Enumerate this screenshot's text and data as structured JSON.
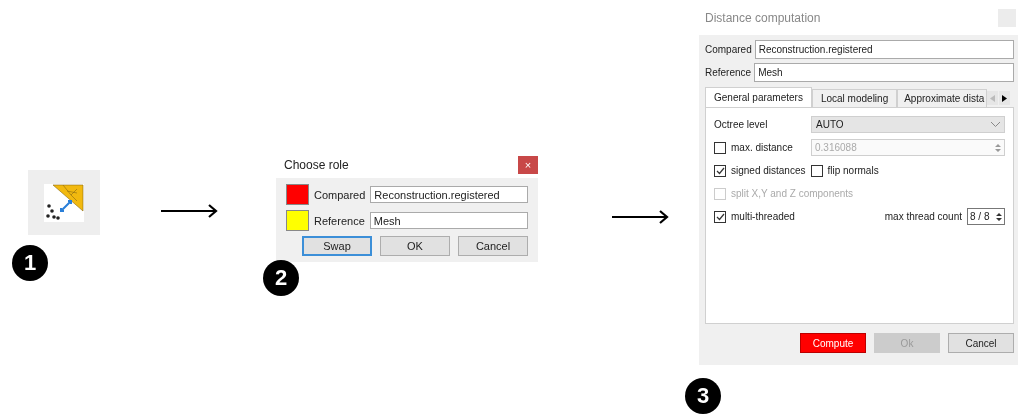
{
  "step_badges": [
    "1",
    "2",
    "3"
  ],
  "choose_role": {
    "title": "Choose role",
    "close": "×",
    "rows": [
      {
        "label": "Compared",
        "value": "Reconstruction.registered",
        "color": "#ff0000"
      },
      {
        "label": "Reference",
        "value": "Mesh",
        "color": "#ffff00"
      }
    ],
    "buttons": [
      {
        "label": "Swap",
        "selected": true
      },
      {
        "label": "OK",
        "selected": false
      },
      {
        "label": "Cancel",
        "selected": false
      }
    ]
  },
  "distance_computation": {
    "title": "Distance computation",
    "fields": [
      {
        "label": "Compared",
        "value": "Reconstruction.registered"
      },
      {
        "label": "Reference",
        "value": "Mesh"
      }
    ],
    "tabs": [
      {
        "label": "General parameters",
        "selected": true
      },
      {
        "label": "Local modeling",
        "selected": false
      },
      {
        "label": "Approximate dista",
        "selected": false
      }
    ],
    "octree_level": {
      "label": "Octree level",
      "value": "AUTO"
    },
    "max_distance": {
      "label": "max. distance",
      "checked": false,
      "value": "0.316088"
    },
    "signed_distances": {
      "label": "signed distances",
      "checked": true
    },
    "flip_normals": {
      "label": "flip normals",
      "checked": false
    },
    "split_components": {
      "label": "split X,Y and Z components",
      "checked": false,
      "disabled": true
    },
    "multi_threaded": {
      "label": "multi-threaded",
      "checked": true
    },
    "max_thread_count": {
      "label": "max thread count",
      "value": "8 / 8"
    },
    "buttons": [
      {
        "label": "Compute",
        "kind": "primary",
        "disabled": false
      },
      {
        "label": "Ok",
        "kind": "normal",
        "disabled": true
      },
      {
        "label": "Cancel",
        "kind": "normal",
        "disabled": false
      }
    ]
  }
}
